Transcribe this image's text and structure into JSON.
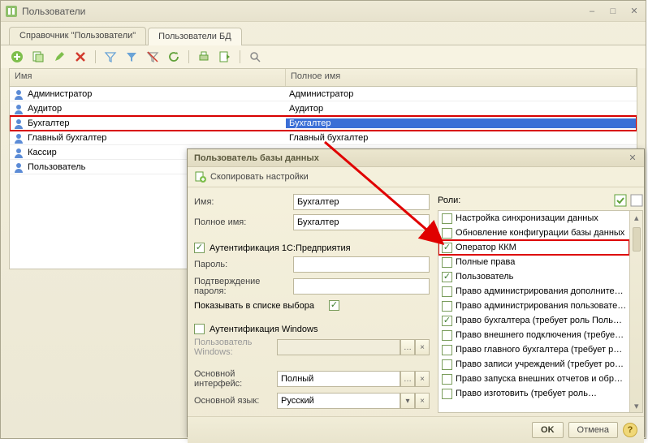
{
  "mainWindow": {
    "title": "Пользователи",
    "tabs": [
      "Справочник \"Пользователи\"",
      "Пользователи БД"
    ],
    "activeTab": 1,
    "columns": [
      "Имя",
      "Полное имя"
    ],
    "rows": [
      {
        "name": "Администратор",
        "full": "Администратор",
        "selected": false
      },
      {
        "name": "Аудитор",
        "full": "Аудитор",
        "selected": false
      },
      {
        "name": "Бухгалтер",
        "full": "Бухгалтер",
        "selected": true
      },
      {
        "name": "Главный бухгалтер",
        "full": "Главный бухгалтер",
        "selected": false
      },
      {
        "name": "Кассир",
        "full": "",
        "selected": false
      },
      {
        "name": "Пользователь",
        "full": "",
        "selected": false
      }
    ]
  },
  "dialog": {
    "title": "Пользователь базы данных",
    "copySettings": "Скопировать настройки",
    "labels": {
      "name": "Имя:",
      "fullName": "Полное имя:",
      "auth1c": "Аутентификация 1С:Предприятия",
      "password": "Пароль:",
      "confirm": "Подтверждение пароля:",
      "showInList": "Показывать в списке выбора",
      "authWin": "Аутентификация Windows",
      "winUser": "Пользователь Windows:",
      "iface": "Основной интерфейс:",
      "lang": "Основной язык:",
      "roles": "Роли:"
    },
    "values": {
      "name": "Бухгалтер",
      "fullName": "Бухгалтер",
      "auth1c": true,
      "showInList": true,
      "authWin": false,
      "winUser": "",
      "iface": "Полный",
      "lang": "Русский"
    },
    "roles": [
      {
        "label": "Настройка синхронизации данных",
        "checked": false,
        "hl": false
      },
      {
        "label": "Обновление конфигурации базы данных",
        "checked": false,
        "hl": false
      },
      {
        "label": "Оператор ККМ",
        "checked": true,
        "hl": true
      },
      {
        "label": "Полные права",
        "checked": false,
        "hl": false
      },
      {
        "label": "Пользователь",
        "checked": true,
        "hl": false
      },
      {
        "label": "Право администрирования дополните…",
        "checked": false,
        "hl": false
      },
      {
        "label": "Право администрирования пользовате…",
        "checked": false,
        "hl": false
      },
      {
        "label": "Право бухгалтера (требует роль Поль…",
        "checked": true,
        "hl": false
      },
      {
        "label": "Право внешнего подключения (требуе…",
        "checked": false,
        "hl": false
      },
      {
        "label": "Право главного бухгалтера (требует р…",
        "checked": false,
        "hl": false
      },
      {
        "label": "Право записи учреждений (требует ро…",
        "checked": false,
        "hl": false
      },
      {
        "label": "Право запуска внешних отчетов и обр…",
        "checked": false,
        "hl": false
      },
      {
        "label": "Право изготовить (требует роль…",
        "checked": false,
        "hl": false
      }
    ],
    "buttons": {
      "ok": "OK",
      "cancel": "Отмена"
    }
  }
}
